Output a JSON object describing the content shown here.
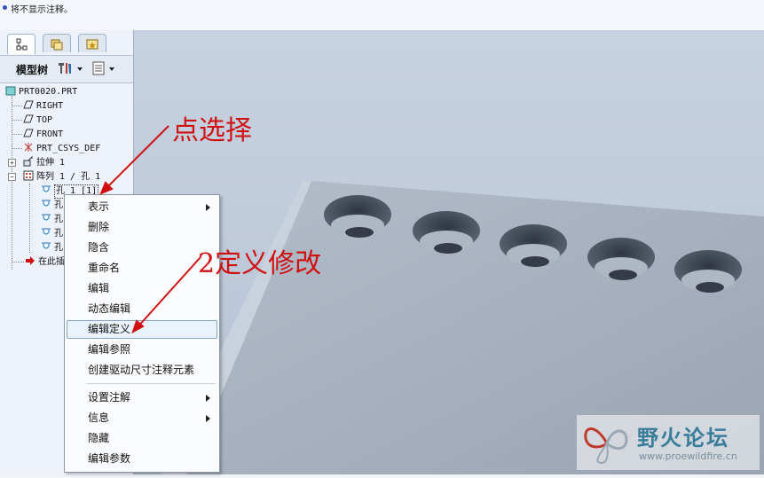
{
  "message_bar": {
    "text": "将不显示注释。"
  },
  "model_tree": {
    "header": {
      "label": "模型树"
    },
    "nodes": [
      {
        "label": "PRT0020.PRT"
      },
      {
        "label": "RIGHT"
      },
      {
        "label": "TOP"
      },
      {
        "label": "FRONT"
      },
      {
        "label": "PRT_CSYS_DEF"
      },
      {
        "label": "拉伸 1"
      },
      {
        "label": "阵列 1 / 孔 1"
      },
      {
        "label": "孔 1 [1]"
      },
      {
        "label": "孔"
      },
      {
        "label": "孔"
      },
      {
        "label": "孔"
      },
      {
        "label": "孔"
      },
      {
        "label": "在此插入"
      }
    ]
  },
  "context_menu": {
    "items": [
      {
        "label": "表示"
      },
      {
        "label": "删除"
      },
      {
        "label": "隐含"
      },
      {
        "label": "重命名"
      },
      {
        "label": "编辑"
      },
      {
        "label": "动态编辑"
      },
      {
        "label": "编辑定义"
      },
      {
        "label": "编辑参照"
      },
      {
        "label": "创建驱动尺寸注释元素"
      },
      {
        "label": "设置注解"
      },
      {
        "label": "信息"
      },
      {
        "label": "隐藏"
      },
      {
        "label": "编辑参数"
      }
    ]
  },
  "annotations": {
    "step1": "点选择",
    "step2": "2定义修改"
  },
  "watermark": {
    "title": "野火论坛",
    "url": "www.proewildfire.cn"
  },
  "colors": {
    "annotation": "#d01010",
    "highlight_border": "#7ea6d8",
    "viewport_bg": "#c2cddd",
    "part_face": "#aab4c2"
  }
}
